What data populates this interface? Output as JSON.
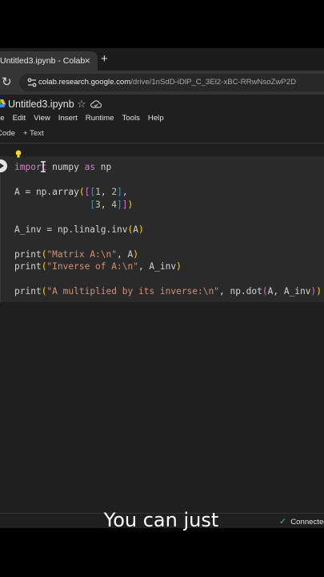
{
  "browser": {
    "tab_title": "Untitled3.ipynb - Colab",
    "tab_close": "×",
    "new_tab": "+",
    "reload": "↻",
    "url_host": "colab.research.google.com",
    "url_path": "/drive/1nSdD-iDlP_C_3El2-xBC-RRwNsoZwP2D"
  },
  "notebook": {
    "title": "Untitled3.ipynb",
    "star": "☆",
    "menu": [
      "ile",
      "Edit",
      "View",
      "Insert",
      "Runtime",
      "Tools",
      "Help"
    ],
    "toolbar": {
      "code": "Code",
      "text": "+ Text"
    }
  },
  "cell": {
    "lines": [
      "import numpy as np",
      "",
      "A = np.array([[1, 2],",
      "              [3, 4]])",
      "",
      "A_inv = np.linalg.inv(A)",
      "",
      "print(\"Matrix A:\\n\", A)",
      "print(\"Inverse of A:\\n\", A_inv)",
      "",
      "print(\"A multiplied by its inverse:\\n\", np.dot(A, A_inv))"
    ]
  },
  "status": {
    "check": "✓",
    "text": "Connected"
  },
  "caption": "You can just",
  "colors": {
    "keyword": "#c586c0",
    "string": "#ce9178",
    "number": "#b5cea8",
    "bracket_1": "#ffd700",
    "bracket_2": "#da70d6",
    "bracket_3": "#179fff",
    "connected": "#5bb974"
  }
}
